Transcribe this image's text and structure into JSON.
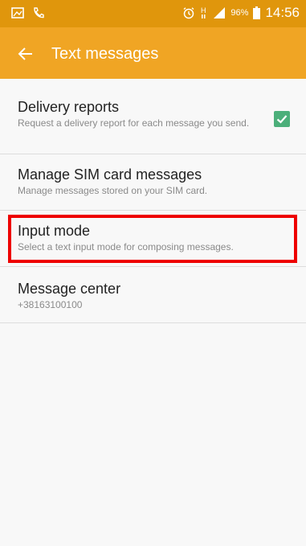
{
  "status_bar": {
    "battery_percent": "96%",
    "time": "14:56",
    "network": "H",
    "icons": [
      "gallery-icon",
      "phone-call-icon",
      "alarm-icon",
      "network-type-icon",
      "signal-icon",
      "battery-icon"
    ]
  },
  "app_bar": {
    "back_icon": "back-arrow-icon",
    "title": "Text messages",
    "color": "#f0a524"
  },
  "settings": {
    "items": [
      {
        "title": "Delivery reports",
        "subtitle": "Request a delivery report for each message you send.",
        "checked": true
      },
      {
        "title": "Manage SIM card messages",
        "subtitle": "Manage messages stored on your SIM card."
      },
      {
        "title": "Input mode",
        "subtitle": "Select a text input mode for composing messages.",
        "highlighted": true
      },
      {
        "title": "Message center",
        "subtitle": "+38163100100"
      }
    ]
  },
  "colors": {
    "status_bar": "#e0960c",
    "checkbox": "#4caf7a",
    "highlight": "#ee0000"
  }
}
